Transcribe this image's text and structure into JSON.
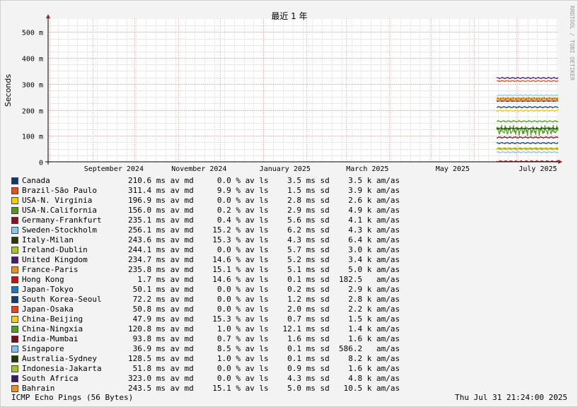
{
  "chart_data": {
    "type": "line",
    "title": "最近 1 年",
    "ylabel": "Seconds",
    "watermark": "RRDTOOL / TOBI OETIKER",
    "yticks": [
      "0",
      "100 m",
      "200 m",
      "300 m",
      "400 m",
      "500 m"
    ],
    "ylim": [
      0,
      0.55
    ],
    "xticks": [
      "September 2024",
      "November 2024",
      "January 2025",
      "March 2025",
      "May 2025",
      "July 2025"
    ],
    "xlim": [
      "2024-07-31",
      "2025-07-31"
    ],
    "data_start": "2025-06-17",
    "grid": true,
    "legend_placement": "bottom",
    "series": [
      {
        "name": "Canada",
        "color": "#0a3a7a",
        "avg_ms": 210.6
      },
      {
        "name": "Brazil-São Paulo",
        "color": "#f24a1a",
        "avg_ms": 311.4
      },
      {
        "name": "USA-N. Virginia",
        "color": "#f0d000",
        "avg_ms": 196.9
      },
      {
        "name": "USA-N.California",
        "color": "#4f9a1a",
        "avg_ms": 156.0
      },
      {
        "name": "Germany-Frankfurt",
        "color": "#8a0f1f",
        "avg_ms": 235.1
      },
      {
        "name": "Sweden-Stockholm",
        "color": "#88c8f0",
        "avg_ms": 256.1
      },
      {
        "name": "Italy-Milan",
        "color": "#2a3a0a",
        "avg_ms": 243.6
      },
      {
        "name": "Ireland-Dublin",
        "color": "#a8c81a",
        "avg_ms": 244.1
      },
      {
        "name": "United Kingdom",
        "color": "#4a1a7a",
        "avg_ms": 234.7
      },
      {
        "name": "France-Paris",
        "color": "#f09010",
        "avg_ms": 235.8
      },
      {
        "name": "Hong Kong",
        "color": "#d01010",
        "avg_ms": 1.7
      },
      {
        "name": "Japan-Tokyo",
        "color": "#1a78c8",
        "avg_ms": 50.1
      },
      {
        "name": "South Korea-Seoul",
        "color": "#10407a",
        "avg_ms": 72.2
      },
      {
        "name": "Japan-Osaka",
        "color": "#f04020",
        "avg_ms": 50.8
      },
      {
        "name": "China-Beijing",
        "color": "#f0d010",
        "avg_ms": 47.9
      },
      {
        "name": "China-Ningxia",
        "color": "#50a020",
        "avg_ms": 120.8
      },
      {
        "name": "India-Mumbai",
        "color": "#800a1a",
        "avg_ms": 93.8
      },
      {
        "name": "Singapore",
        "color": "#80c0f0",
        "avg_ms": 36.9
      },
      {
        "name": "Australia-Sydney",
        "color": "#20380a",
        "avg_ms": 128.5
      },
      {
        "name": "Indonesia-Jakarta",
        "color": "#a0c818",
        "avg_ms": 51.8
      },
      {
        "name": "South Africa",
        "color": "#3a1870",
        "avg_ms": 323.0
      },
      {
        "name": "Bahrain",
        "color": "#f09018",
        "avg_ms": 243.5
      }
    ]
  },
  "legend": [
    {
      "name": "Canada",
      "stats": "210.6 ms av md     0.0 % av ls    3.5 ms sd    3.5 k am/as"
    },
    {
      "name": "Brazil-São Paulo",
      "stats": "311.4 ms av md     9.9 % av ls    1.5 ms sd    3.9 k am/as"
    },
    {
      "name": "USA-N. Virginia",
      "stats": "196.9 ms av md     0.0 % av ls    2.8 ms sd    2.6 k am/as"
    },
    {
      "name": "USA-N.California",
      "stats": "156.0 ms av md     0.2 % av ls    2.9 ms sd    4.9 k am/as"
    },
    {
      "name": "Germany-Frankfurt",
      "stats": "235.1 ms av md     0.4 % av ls    5.6 ms sd    4.1 k am/as"
    },
    {
      "name": "Sweden-Stockholm",
      "stats": "256.1 ms av md    15.2 % av ls    6.2 ms sd    4.3 k am/as"
    },
    {
      "name": "Italy-Milan",
      "stats": "243.6 ms av md    15.3 % av ls    4.3 ms sd    6.4 k am/as"
    },
    {
      "name": "Ireland-Dublin",
      "stats": "244.1 ms av md     0.0 % av ls    5.7 ms sd    3.0 k am/as"
    },
    {
      "name": "United Kingdom",
      "stats": "234.7 ms av md    14.6 % av ls    5.2 ms sd    3.4 k am/as"
    },
    {
      "name": "France-Paris",
      "stats": "235.8 ms av md    15.1 % av ls    5.1 ms sd    5.0 k am/as"
    },
    {
      "name": "Hong Kong",
      "stats": "  1.7 ms av md    14.6 % av ls    0.1 ms sd  182.5   am/as"
    },
    {
      "name": "Japan-Tokyo",
      "stats": " 50.1 ms av md     0.0 % av ls    0.2 ms sd    2.9 k am/as"
    },
    {
      "name": "South Korea-Seoul",
      "stats": " 72.2 ms av md     0.0 % av ls    1.2 ms sd    2.8 k am/as"
    },
    {
      "name": "Japan-Osaka",
      "stats": " 50.8 ms av md     0.0 % av ls    2.0 ms sd    2.2 k am/as"
    },
    {
      "name": "China-Beijing",
      "stats": " 47.9 ms av md    15.3 % av ls    0.7 ms sd    1.5 k am/as"
    },
    {
      "name": "China-Ningxia",
      "stats": "120.8 ms av md     1.0 % av ls   12.1 ms sd    1.4 k am/as"
    },
    {
      "name": "India-Mumbai",
      "stats": " 93.8 ms av md     0.7 % av ls    1.6 ms sd    1.6 k am/as"
    },
    {
      "name": "Singapore",
      "stats": " 36.9 ms av md     8.5 % av ls    0.1 ms sd  586.2   am/as"
    },
    {
      "name": "Australia-Sydney",
      "stats": "128.5 ms av md     1.0 % av ls    0.1 ms sd    8.2 k am/as"
    },
    {
      "name": "Indonesia-Jakarta",
      "stats": " 51.8 ms av md     0.0 % av ls    0.9 ms sd    1.6 k am/as"
    },
    {
      "name": "South Africa",
      "stats": "323.0 ms av md     0.0 % av ls    4.3 ms sd    4.8 k am/as"
    },
    {
      "name": "Bahrain",
      "stats": "243.5 ms av md    15.1 % av ls    5.0 ms sd   10.5 k am/as"
    }
  ],
  "footer": {
    "description": "ICMP Echo Pings (56 Bytes)",
    "timestamp": "Thu Jul 31 21:24:00 2025"
  }
}
